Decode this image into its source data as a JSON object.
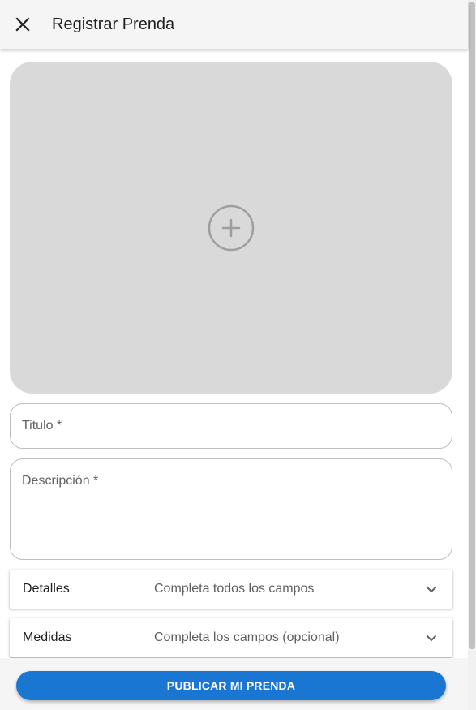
{
  "header": {
    "title": "Registrar Prenda",
    "close_icon": "close-icon"
  },
  "image_upload": {
    "icon": "add-circle-icon",
    "background_color": "#d9d9d9"
  },
  "form": {
    "title_field": {
      "label": "Titulo *",
      "value": ""
    },
    "description_field": {
      "label": "Descripción *",
      "value": ""
    }
  },
  "panels": [
    {
      "title": "Detalles",
      "subtitle": "Completa todos los campos",
      "icon": "chevron-down-icon"
    },
    {
      "title": "Medidas",
      "subtitle": "Completa los campos (opcional)",
      "icon": "chevron-down-icon"
    }
  ],
  "footer": {
    "publish_label": "PUBLICAR MI PRENDA"
  },
  "colors": {
    "accent": "#1976d2",
    "header_bg": "#f5f5f5",
    "placeholder_bg": "#d9d9d9"
  }
}
